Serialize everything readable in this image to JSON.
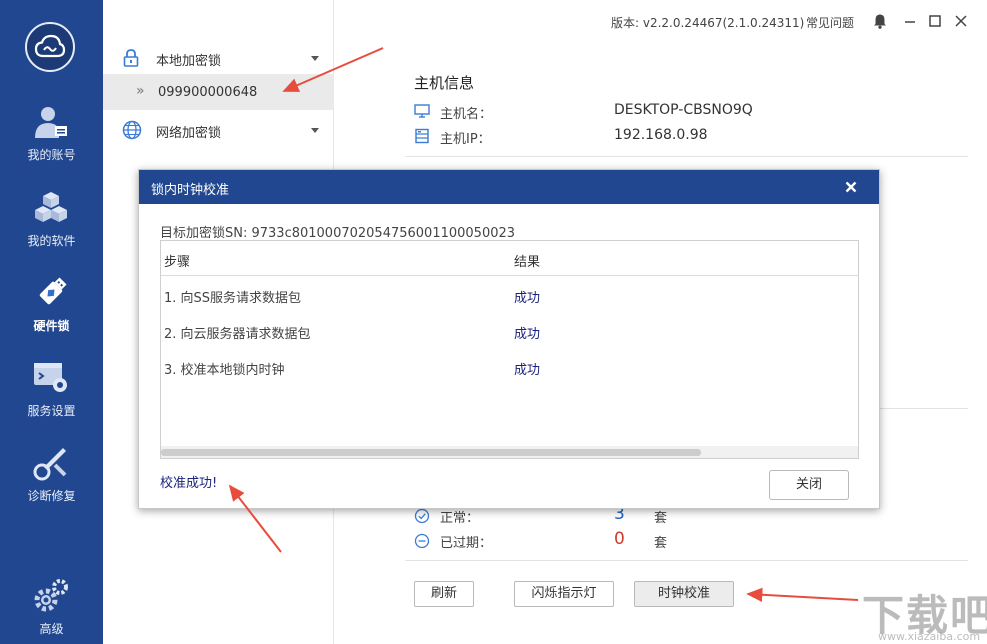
{
  "topbar": {
    "version": "版本: v2.2.0.24467(2.1.0.24311)",
    "faq": "常见问题"
  },
  "nav": {
    "items": [
      {
        "label": "我的账号",
        "icon": "user-account-icon"
      },
      {
        "label": "我的软件",
        "icon": "cubes-icon"
      },
      {
        "label": "硬件锁",
        "icon": "usb-key-icon"
      },
      {
        "label": "服务设置",
        "icon": "terminal-gear-icon"
      },
      {
        "label": "诊断修复",
        "icon": "wrench-icon"
      },
      {
        "label": "高级",
        "icon": "gears-icon"
      }
    ]
  },
  "devices": {
    "local_label": "本地加密锁",
    "local_item": "099900000648",
    "network_label": "网络加密锁"
  },
  "host": {
    "title": "主机信息",
    "name_label": "主机名：",
    "name_value": "DESKTOP-CBSNO9Q",
    "ip_label": "主机IP：",
    "ip_value": "192.168.0.98"
  },
  "stats": {
    "normal_label": "正常：",
    "normal_value": "3",
    "expired_label": "已过期：",
    "expired_value": "0",
    "unit": "套"
  },
  "actions": {
    "refresh": "刷新",
    "blink": "闪烁指示灯",
    "clock": "时钟校准"
  },
  "dialog": {
    "title": "锁内时钟校准",
    "sn_line": "目标加密锁SN: 9733c801000702054756001100050023",
    "headers": {
      "step": "步骤",
      "result": "结果"
    },
    "rows": [
      {
        "step": "1. 向SS服务请求数据包",
        "result": "成功"
      },
      {
        "step": "2. 向云服务器请求数据包",
        "result": "成功"
      },
      {
        "step": "3. 校准本地锁内时钟",
        "result": "成功"
      }
    ],
    "status": "校准成功!",
    "close": "关闭"
  },
  "colors": {
    "nav_bg": "#20478f",
    "dialog_title_bg": "#20478f",
    "success_text": "#1a237e",
    "normal_count": "#1f5fbf",
    "expired_count": "#d0392b",
    "annotation_arrow": "#e74c3c"
  },
  "watermark": {
    "big": "下载吧",
    "small": "www.xiazaiba.com"
  }
}
